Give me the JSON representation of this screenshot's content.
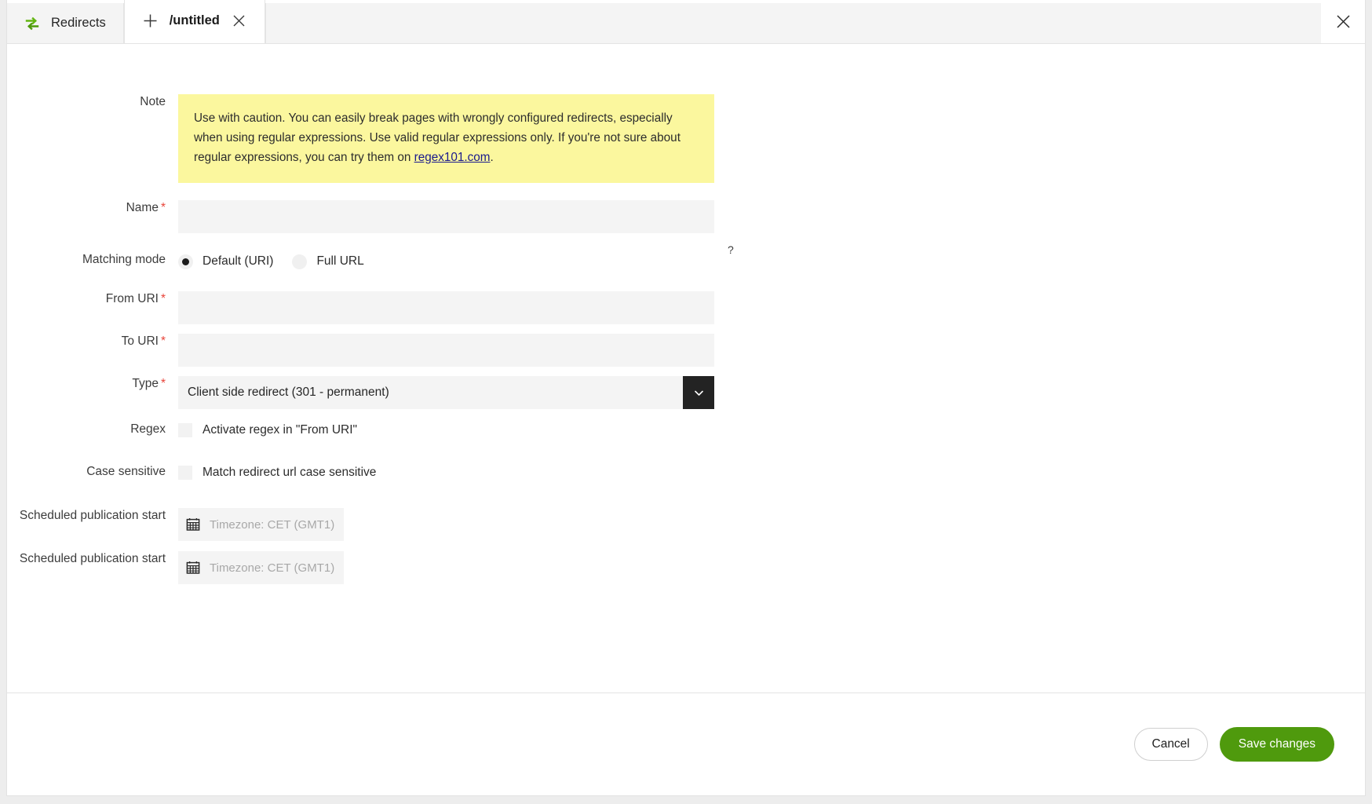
{
  "window": {
    "close_icon": "close-icon"
  },
  "tabs": [
    {
      "label": "Redirects",
      "icon": "swap-arrows-icon",
      "active": false,
      "closable": false
    },
    {
      "label": "/untitled",
      "icon": "plus-icon",
      "active": true,
      "closable": true
    }
  ],
  "form": {
    "note": {
      "label": "Note",
      "text_before": "Use with caution. You can easily break pages with wrongly configured redirects, especially when using regular expressions. Use valid regular expressions only. If you're not sure about regular expressions, you can try them on ",
      "link_text": "regex101.com",
      "text_after": ".",
      "background": "#fbf79e"
    },
    "name": {
      "label": "Name",
      "required": true,
      "value": "",
      "placeholder": ""
    },
    "matching_mode": {
      "label": "Matching mode",
      "options": [
        {
          "label": "Default (URI)",
          "selected": true
        },
        {
          "label": "Full URL",
          "selected": false
        }
      ],
      "help_icon": "question-mark-icon",
      "help_label": "?"
    },
    "from_uri": {
      "label": "From URI",
      "required": true,
      "value": "",
      "placeholder": ""
    },
    "to_uri": {
      "label": "To URI",
      "required": true,
      "value": "",
      "placeholder": ""
    },
    "type": {
      "label": "Type",
      "required": true,
      "value": "Client side redirect (301 - permanent)",
      "toggle_icon": "chevron-down-icon"
    },
    "regex": {
      "label": "Regex",
      "checkbox_label": "Activate regex in \"From URI\"",
      "checked": false
    },
    "case_sensitive": {
      "label": "Case sensitive",
      "checkbox_label": "Match redirect url case sensitive",
      "checked": false
    },
    "schedule_start": {
      "label": "Scheduled publication start",
      "icon": "calendar-icon",
      "placeholder": "Timezone: CET (GMT1)",
      "value": ""
    },
    "schedule_start_2": {
      "label": "Scheduled publication start",
      "icon": "calendar-icon",
      "placeholder": "Timezone: CET (GMT1)",
      "value": ""
    },
    "required_marker": "*"
  },
  "footer": {
    "cancel_label": "Cancel",
    "save_label": "Save changes",
    "save_color": "#4f9a0d"
  }
}
